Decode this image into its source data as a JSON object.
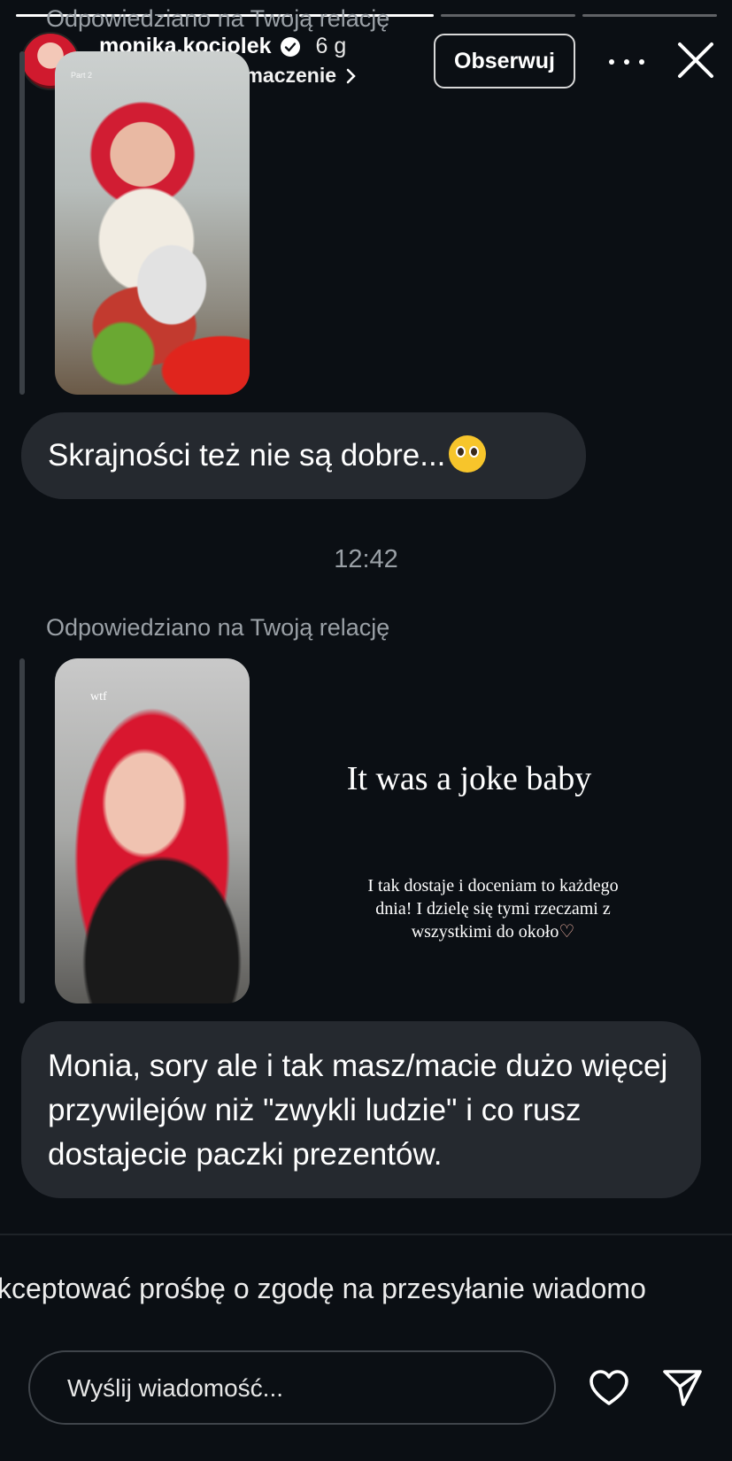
{
  "story": {
    "progress_segments": [
      1.0,
      1.0,
      1.0,
      0.0,
      0.0
    ]
  },
  "header": {
    "username": "monika.kociolek",
    "time_ago": "6 g",
    "translate_label": "Wyświetl tłumaczenie",
    "follow_label": "Obserwuj",
    "icons": [
      "verified-icon",
      "translate-icon",
      "chevron-right-icon",
      "more-icon",
      "close-icon"
    ]
  },
  "messages": [
    {
      "reply_label": "Odpowiedziano na Twoją relację",
      "thumbnail_caption": "Part 2",
      "text": "Skrajności też nie są dobre..."
    },
    {
      "timestamp": "12:42",
      "reply_label": "Odpowiedziano na Twoją relację",
      "thumbnail_caption": "wtf",
      "story_title": "It was a joke baby",
      "story_body": "I tak dostaje i doceniam to każdego dnia! I dzielę się tymi rzeczami z wszystkimi do około",
      "text": "Monia, sory ale i tak masz/macie dużo więcej przywilejów niż \"zwykli ludzie\" i co rusz dostajecie paczki prezentów."
    }
  ],
  "footer": {
    "accept_request": "kceptować prośbę o zgodę na przesyłanie wiadomo",
    "input_placeholder": "Wyślij wiadomość...",
    "icons": [
      "heart-icon",
      "send-icon"
    ]
  },
  "colors": {
    "background": "#0b0f14",
    "bubble": "#25292f",
    "muted_text": "#9aa0a6"
  }
}
